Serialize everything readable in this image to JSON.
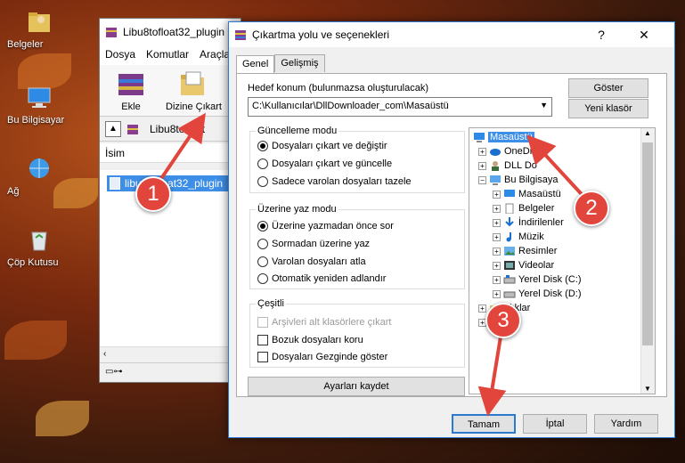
{
  "desktop": {
    "icons": [
      {
        "label": "Belgeler"
      },
      {
        "label": "Bu Bilgisayar"
      },
      {
        "label": "Ağ"
      },
      {
        "label": "Çöp Kutusu"
      }
    ]
  },
  "winrar": {
    "title": "Libu8tofloat32_plugin",
    "menu": [
      "Dosya",
      "Komutlar",
      "Araçla"
    ],
    "tools": [
      {
        "label": "Ekle"
      },
      {
        "label": "Dizine Çıkart"
      }
    ],
    "path_text": "Libu8tofloat",
    "list_header": "İsim",
    "selected_file": "libu8tofloat32_plugin"
  },
  "dialog": {
    "title": "Çıkartma yolu ve seçenekleri",
    "help_btn": "?",
    "close_btn": "✕",
    "tabs": [
      "Genel",
      "Gelişmiş"
    ],
    "dest_label": "Hedef konum (bulunmazsa oluşturulacak)",
    "dest_value": "C:\\Kullanıcılar\\DllDownloader_com\\Masaüstü",
    "show_btn": "Göster",
    "new_folder_btn": "Yeni klasör",
    "update_mode": {
      "title": "Güncelleme modu",
      "options": [
        "Dosyaları çıkart ve değiştir",
        "Dosyaları çıkart ve güncelle",
        "Sadece varolan dosyaları tazele"
      ],
      "selected": 0
    },
    "overwrite_mode": {
      "title": "Üzerine yaz modu",
      "options": [
        "Üzerine yazmadan önce sor",
        "Sormadan üzerine yaz",
        "Varolan dosyaları atla",
        "Otomatik yeniden adlandır"
      ],
      "selected": 0
    },
    "misc": {
      "title": "Çeşitli",
      "options": [
        "Arşivleri alt klasörlere çıkart",
        "Bozuk dosyaları koru",
        "Dosyaları Gezginde göster"
      ],
      "disabled": [
        true,
        false,
        false
      ],
      "checked": [
        false,
        false,
        false
      ]
    },
    "save_settings_btn": "Ayarları kaydet",
    "tree": [
      {
        "label": "Masaüstü",
        "icon": "desktop-icon",
        "selected": true
      },
      {
        "label": "OneDr",
        "icon": "cloud-icon"
      },
      {
        "label": "DLL Do",
        "icon": "user-icon"
      },
      {
        "label": "Bu Bilgisaya",
        "icon": "computer-icon"
      },
      {
        "label": "Masaüstü",
        "icon": "desktop-icon"
      },
      {
        "label": "Belgeler",
        "icon": "document-icon"
      },
      {
        "label": "İndirilenler",
        "icon": "download-icon"
      },
      {
        "label": "Müzik",
        "icon": "music-icon"
      },
      {
        "label": "Resimler",
        "icon": "picture-icon"
      },
      {
        "label": "Videolar",
        "icon": "video-icon"
      },
      {
        "label": "Yerel Disk (C:)",
        "icon": "drive-icon"
      },
      {
        "label": "Yerel Disk (D:)",
        "icon": "drive-icon"
      },
      {
        "label": "plıklar",
        "icon": "folder-icon"
      }
    ],
    "ok_btn": "Tamam",
    "cancel_btn": "İptal",
    "help_bottom_btn": "Yardım"
  },
  "annotations": [
    "1",
    "2",
    "3"
  ],
  "colors": {
    "accent": "#2b79d1",
    "selection": "#3d8ee6",
    "badge": "#e2453b"
  }
}
